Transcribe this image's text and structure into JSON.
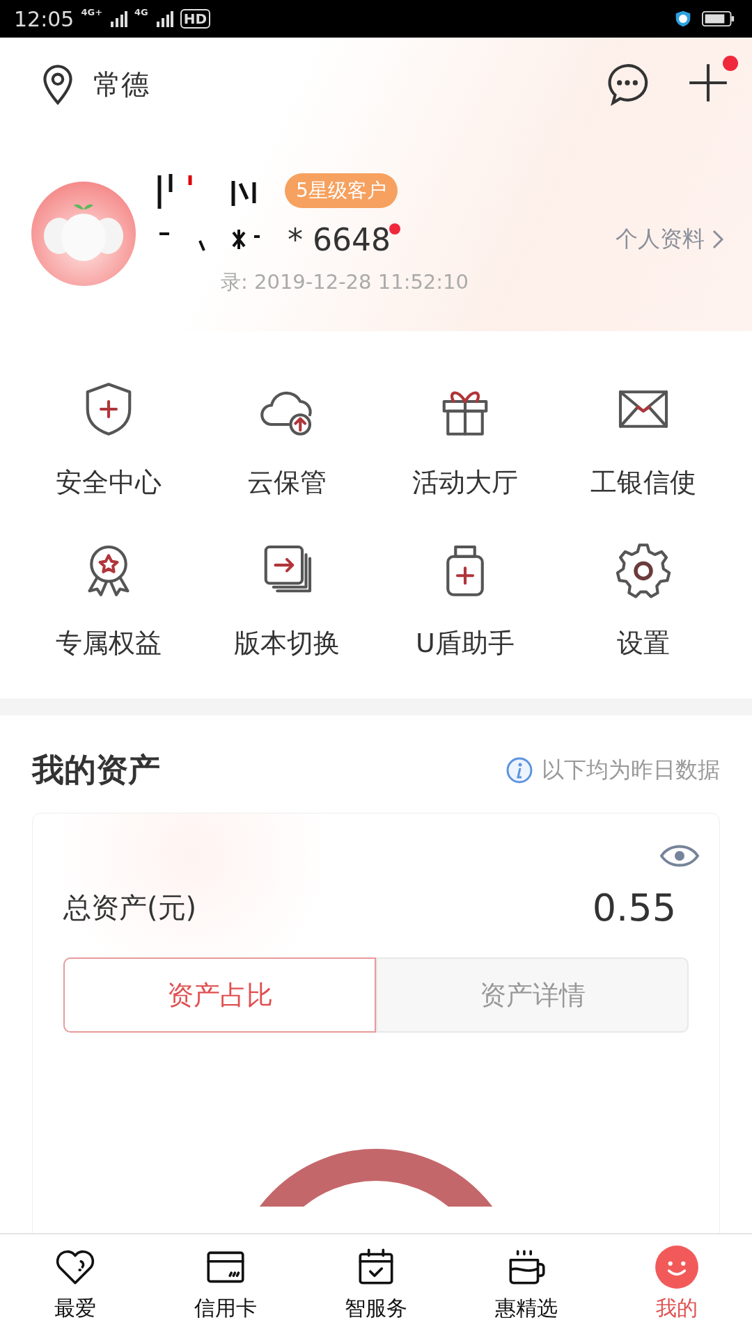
{
  "status_bar": {
    "time": "12:05",
    "network_1": "4G+",
    "network_2": "4G",
    "hd": "HD"
  },
  "header": {
    "city": "常德",
    "plus_badge": true
  },
  "profile": {
    "badge": "5星级客户",
    "account": "* 6648",
    "account_dot": true,
    "profile_link": "个人资料",
    "last_login": "录: 2019-12-28 11:52:10"
  },
  "shortcuts": [
    {
      "label": "安全中心"
    },
    {
      "label": "云保管"
    },
    {
      "label": "活动大厅"
    },
    {
      "label": "工银信使"
    },
    {
      "label": "专属权益"
    },
    {
      "label": "版本切换"
    },
    {
      "label": "U盾助手"
    },
    {
      "label": "设置"
    }
  ],
  "assets": {
    "title": "我的资产",
    "note": "以下均为昨日数据",
    "total_label": "总资产(元)",
    "total_value": "0.55",
    "tabs": [
      {
        "label": "资产占比",
        "selected": true
      },
      {
        "label": "资产详情",
        "selected": false
      }
    ]
  },
  "bottom_nav": [
    {
      "label": "最爱",
      "selected": false
    },
    {
      "label": "信用卡",
      "selected": false
    },
    {
      "label": "智服务",
      "selected": false
    },
    {
      "label": "惠精选",
      "selected": false
    },
    {
      "label": "我的",
      "selected": true
    }
  ]
}
